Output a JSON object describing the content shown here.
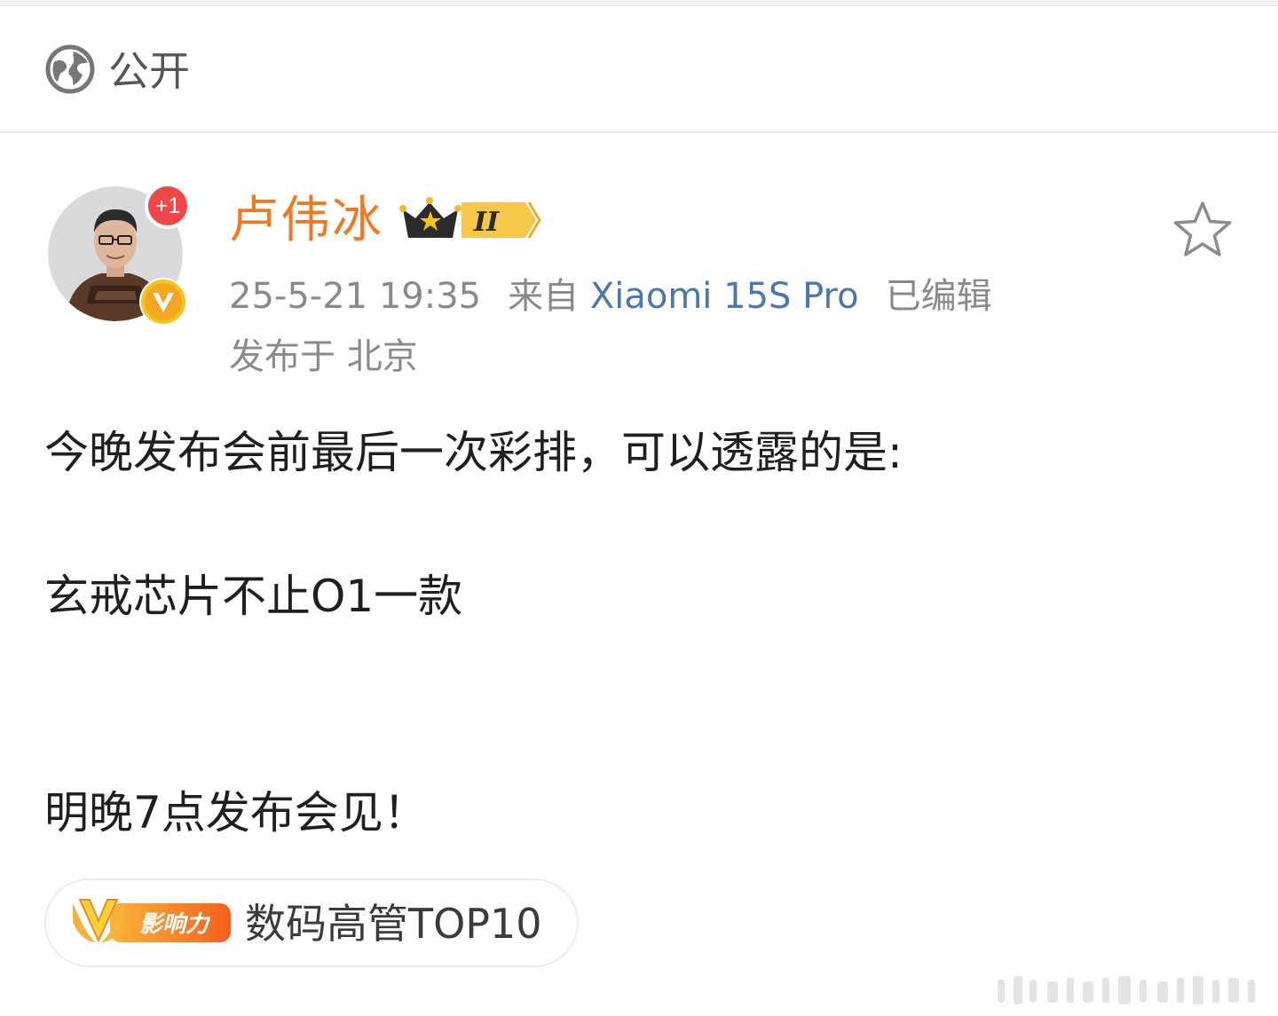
{
  "visibility": {
    "icon": "globe-icon",
    "label": "公开"
  },
  "author": {
    "name": "卢伟冰",
    "plus_badge": "+1",
    "verified_badge": "V",
    "crown_level": "II",
    "name_color": "#f07a22"
  },
  "meta": {
    "timestamp": "25-5-21 19:35",
    "source_prefix": "来自",
    "device": "Xiaomi 15S Pro",
    "edited": "已编辑",
    "location": "发布于 北京",
    "device_color": "#4a77ad"
  },
  "post": {
    "lines": [
      "今晚发布会前最后一次彩排，可以透露的是:",
      "玄戒芯片不止O1一款",
      "明晚7点发布会见！"
    ]
  },
  "topic_chip": {
    "badge_text": "影响力",
    "label": "数码高管TOP10"
  },
  "favorite": {
    "icon": "star-icon"
  }
}
